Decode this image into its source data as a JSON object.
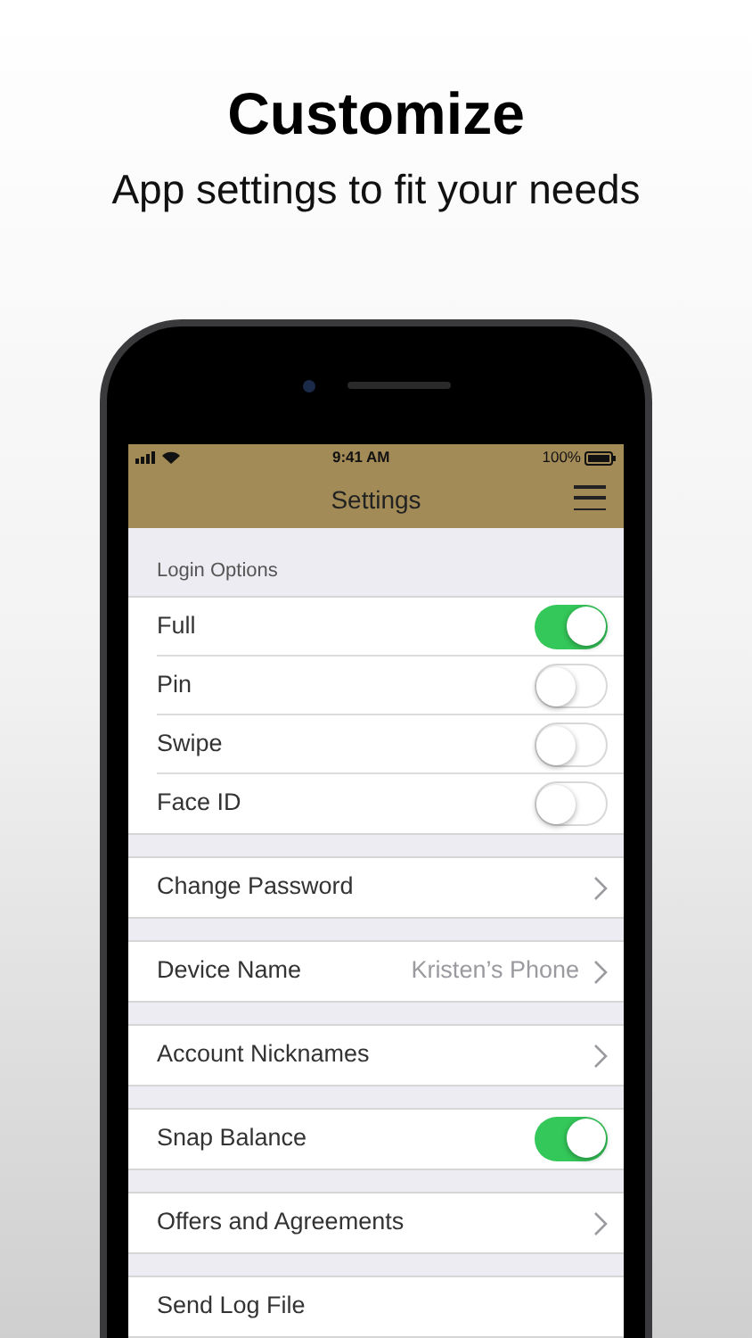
{
  "headline": "Customize",
  "subtitle": "App settings to fit your needs",
  "status_bar": {
    "time": "9:41 AM",
    "battery": "100%"
  },
  "nav_bar": {
    "title": "Settings"
  },
  "groups": [
    {
      "header": "Login Options",
      "rows": [
        {
          "kind": "toggle",
          "label": "Full",
          "on": true
        },
        {
          "kind": "toggle",
          "label": "Pin",
          "on": false
        },
        {
          "kind": "toggle",
          "label": "Swipe",
          "on": false
        },
        {
          "kind": "toggle",
          "label": "Face ID",
          "on": false
        }
      ]
    },
    {
      "rows": [
        {
          "kind": "link",
          "label": "Change Password"
        }
      ]
    },
    {
      "rows": [
        {
          "kind": "link",
          "label": "Device Name",
          "value": "Kristen’s Phone"
        }
      ]
    },
    {
      "rows": [
        {
          "kind": "link",
          "label": "Account Nicknames"
        }
      ]
    },
    {
      "rows": [
        {
          "kind": "toggle",
          "label": "Snap Balance",
          "on": true
        }
      ]
    },
    {
      "rows": [
        {
          "kind": "link",
          "label": "Offers and Agreements"
        }
      ]
    },
    {
      "rows": [
        {
          "kind": "plain",
          "label": "Send Log File"
        }
      ]
    }
  ]
}
